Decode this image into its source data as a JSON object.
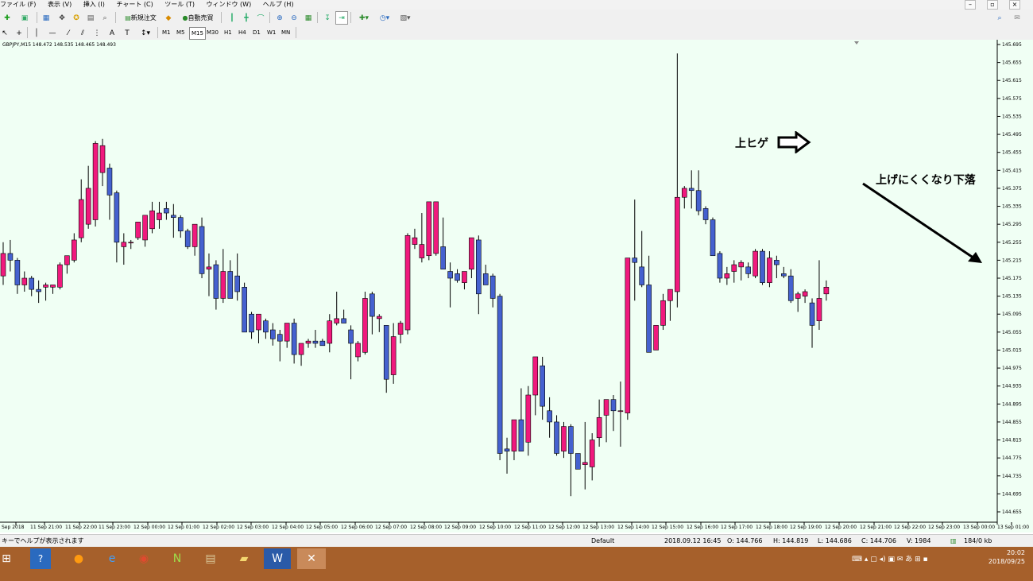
{
  "menu": {
    "items": [
      "ファイル (F)",
      "表示 (V)",
      "挿入 (I)",
      "チャート (C)",
      "ツール (T)",
      "ウィンドウ (W)",
      "ヘルプ (H)"
    ]
  },
  "toolbar": {
    "new_order": "新規注文",
    "auto_trade": "自動売買"
  },
  "timeframes": [
    "M1",
    "M5",
    "M15",
    "M30",
    "H1",
    "H4",
    "D1",
    "W1",
    "MN"
  ],
  "active_timeframe": "M15",
  "chart_header": "GBPJPY,M15  148.472 148.535 148.465 148.493",
  "annotations": {
    "upper_wick": "上ヒゲ",
    "not_rising": "上げにくくなり下落"
  },
  "status": {
    "help": "キーでヘルプが表示されます",
    "profile": "Default",
    "datetime": "2018.09.12 16:45",
    "open": "O: 144.766",
    "high": "H: 144.819",
    "low": "L: 144.686",
    "close": "C: 144.706",
    "volume": "V: 1984",
    "traffic": "184/0 kb"
  },
  "clock": {
    "time": "20:02",
    "date": "2018/09/25"
  },
  "colors": {
    "bull": "#f0197d",
    "bear": "#4561cf",
    "chart_bg": "#f0fff4"
  },
  "chart_data": {
    "type": "candlestick",
    "symbol": "GBPJPY",
    "timeframe": "M15",
    "ylim": [
      144.655,
      145.695
    ],
    "y_ticks": [
      "145.695",
      "145.655",
      "145.615",
      "145.575",
      "145.535",
      "145.495",
      "145.455",
      "145.415",
      "145.375",
      "145.335",
      "145.295",
      "145.255",
      "145.215",
      "145.175",
      "145.135",
      "145.095",
      "145.055",
      "145.015",
      "144.975",
      "144.935",
      "144.895",
      "144.855",
      "144.815",
      "144.775",
      "144.735",
      "144.695",
      "144.655"
    ],
    "x_ticks": [
      "Sep 2018",
      "11 Sep 21:00",
      "11 Sep 22:00",
      "11 Sep 23:00",
      "12 Sep 00:00",
      "12 Sep 01:00",
      "12 Sep 02:00",
      "12 Sep 03:00",
      "12 Sep 04:00",
      "12 Sep 05:00",
      "12 Sep 06:00",
      "12 Sep 07:00",
      "12 Sep 08:00",
      "12 Sep 09:00",
      "12 Sep 10:00",
      "12 Sep 11:00",
      "12 Sep 12:00",
      "12 Sep 13:00",
      "12 Sep 14:00",
      "12 Sep 15:00",
      "12 Sep 16:00",
      "12 Sep 17:00",
      "12 Sep 18:00",
      "12 Sep 19:00",
      "12 Sep 20:00",
      "12 Sep 21:00",
      "12 Sep 22:00",
      "12 Sep 23:00",
      "13 Sep 00:00",
      "13 Sep 01:00"
    ],
    "candles": [
      [
        145.18,
        145.255,
        145.16,
        145.23
      ],
      [
        145.23,
        145.26,
        145.19,
        145.215
      ],
      [
        145.215,
        145.22,
        145.14,
        145.16
      ],
      [
        145.16,
        145.19,
        145.145,
        145.175
      ],
      [
        145.175,
        145.18,
        145.135,
        145.15
      ],
      [
        145.15,
        145.17,
        145.12,
        145.145
      ],
      [
        145.155,
        145.165,
        145.125,
        145.16
      ],
      [
        145.155,
        145.16,
        145.14,
        145.16
      ],
      [
        145.155,
        145.21,
        145.15,
        145.205
      ],
      [
        145.205,
        145.225,
        145.185,
        145.225
      ],
      [
        145.215,
        145.275,
        145.21,
        145.26
      ],
      [
        145.265,
        145.395,
        145.255,
        145.35
      ],
      [
        145.295,
        145.425,
        145.285,
        145.375
      ],
      [
        145.305,
        145.48,
        145.29,
        145.475
      ],
      [
        145.41,
        145.485,
        145.38,
        145.47
      ],
      [
        145.42,
        145.43,
        145.305,
        145.36
      ],
      [
        145.365,
        145.37,
        145.21,
        145.255
      ],
      [
        145.245,
        145.275,
        145.205,
        145.255
      ],
      [
        145.255,
        145.26,
        145.24,
        145.255
      ],
      [
        145.265,
        145.3,
        145.26,
        145.3
      ],
      [
        145.26,
        145.305,
        145.245,
        145.315
      ],
      [
        145.285,
        145.345,
        145.275,
        145.325
      ],
      [
        145.305,
        145.345,
        145.285,
        145.32
      ],
      [
        145.33,
        145.345,
        145.305,
        145.32
      ],
      [
        145.315,
        145.34,
        145.265,
        145.31
      ],
      [
        145.31,
        145.315,
        145.265,
        145.28
      ],
      [
        145.28,
        145.285,
        145.24,
        145.245
      ],
      [
        145.245,
        145.295,
        145.225,
        145.295
      ],
      [
        145.29,
        145.31,
        145.175,
        145.185
      ],
      [
        145.195,
        145.23,
        145.135,
        145.2
      ],
      [
        145.205,
        145.215,
        145.105,
        145.13
      ],
      [
        145.13,
        145.24,
        145.12,
        145.19
      ],
      [
        145.19,
        145.215,
        145.135,
        145.13
      ],
      [
        145.18,
        145.23,
        145.125,
        145.145
      ],
      [
        145.155,
        145.165,
        145.055,
        145.055
      ],
      [
        145.095,
        145.1,
        145.04,
        145.055
      ],
      [
        145.06,
        145.095,
        145.03,
        145.095
      ],
      [
        145.08,
        145.085,
        145.04,
        145.055
      ],
      [
        145.06,
        145.075,
        145.025,
        145.04
      ],
      [
        145.05,
        145.06,
        144.99,
        145.035
      ],
      [
        145.035,
        145.065,
        145.02,
        145.075
      ],
      [
        145.075,
        145.085,
        144.985,
        145.005
      ],
      [
        145.005,
        145.02,
        144.98,
        145.03
      ],
      [
        145.03,
        145.04,
        145.02,
        145.035
      ],
      [
        145.035,
        145.06,
        145.02,
        145.03
      ],
      [
        145.035,
        145.04,
        145.025,
        145.025
      ],
      [
        145.03,
        145.095,
        145.01,
        145.08
      ],
      [
        145.075,
        145.145,
        145.07,
        145.085
      ],
      [
        145.085,
        145.105,
        145.075,
        145.075
      ],
      [
        145.06,
        145.07,
        144.95,
        145.03
      ],
      [
        145.0,
        145.035,
        144.99,
        145.03
      ],
      [
        145.01,
        145.145,
        145.005,
        145.13
      ],
      [
        145.14,
        145.145,
        145.05,
        145.09
      ],
      [
        145.085,
        145.095,
        145.055,
        145.09
      ],
      [
        145.07,
        145.07,
        144.92,
        144.95
      ],
      [
        144.96,
        145.075,
        144.94,
        145.045
      ],
      [
        145.05,
        145.08,
        145.03,
        145.075
      ],
      [
        145.06,
        145.275,
        145.05,
        145.27
      ],
      [
        145.25,
        145.285,
        145.24,
        145.265
      ],
      [
        145.22,
        145.32,
        145.21,
        145.25
      ],
      [
        145.225,
        145.3,
        145.215,
        145.345
      ],
      [
        145.23,
        145.345,
        145.225,
        145.345
      ],
      [
        145.245,
        145.31,
        145.23,
        145.195
      ],
      [
        145.19,
        145.21,
        145.11,
        145.175
      ],
      [
        145.185,
        145.195,
        145.165,
        145.17
      ],
      [
        145.165,
        145.185,
        145.15,
        145.19
      ],
      [
        145.195,
        145.25,
        145.175,
        145.265
      ],
      [
        145.26,
        145.27,
        145.095,
        145.14
      ],
      [
        145.185,
        145.205,
        145.16,
        145.16
      ],
      [
        145.18,
        145.185,
        145.11,
        145.13
      ],
      [
        145.135,
        145.14,
        144.77,
        144.785
      ],
      [
        144.795,
        144.82,
        144.74,
        144.79
      ],
      [
        144.79,
        144.84,
        144.77,
        144.86
      ],
      [
        144.86,
        144.93,
        144.79,
        144.79
      ],
      [
        144.81,
        144.935,
        144.78,
        144.915
      ],
      [
        144.915,
        144.98,
        144.87,
        145.0
      ],
      [
        144.98,
        145.0,
        144.86,
        144.89
      ],
      [
        144.88,
        144.91,
        144.82,
        144.855
      ],
      [
        144.855,
        144.87,
        144.78,
        144.785
      ],
      [
        144.79,
        144.855,
        144.775,
        144.845
      ],
      [
        144.845,
        144.85,
        144.69,
        144.785
      ],
      [
        144.785,
        144.78,
        144.76,
        144.75
      ],
      [
        144.76,
        144.855,
        144.705,
        144.765
      ],
      [
        144.755,
        144.83,
        144.725,
        144.815
      ],
      [
        144.82,
        144.905,
        144.8,
        144.865
      ],
      [
        144.87,
        144.9,
        144.81,
        144.905
      ],
      [
        144.905,
        144.915,
        144.835,
        144.88
      ],
      [
        144.88,
        144.945,
        144.8,
        144.88
      ],
      [
        144.875,
        145.215,
        144.86,
        145.22
      ],
      [
        145.22,
        145.35,
        145.125,
        145.21
      ],
      [
        145.2,
        145.28,
        145.155,
        145.16
      ],
      [
        145.16,
        145.225,
        145.05,
        145.01
      ],
      [
        145.015,
        145.06,
        145.02,
        145.07
      ],
      [
        145.07,
        145.14,
        145.06,
        145.125
      ],
      [
        145.125,
        145.15,
        145.08,
        145.15
      ],
      [
        145.145,
        145.675,
        145.11,
        145.355
      ],
      [
        145.355,
        145.38,
        145.33,
        145.375
      ],
      [
        145.375,
        145.415,
        145.33,
        145.37
      ],
      [
        145.37,
        145.415,
        145.315,
        145.325
      ],
      [
        145.33,
        145.335,
        145.295,
        145.305
      ],
      [
        145.305,
        145.31,
        145.225,
        145.225
      ],
      [
        145.23,
        145.235,
        145.165,
        145.175
      ],
      [
        145.175,
        145.2,
        145.16,
        145.185
      ],
      [
        145.19,
        145.215,
        145.165,
        145.205
      ],
      [
        145.2,
        145.215,
        145.17,
        145.21
      ],
      [
        145.2,
        145.21,
        145.175,
        145.185
      ],
      [
        145.18,
        145.24,
        145.175,
        145.235
      ],
      [
        145.235,
        145.24,
        145.16,
        145.165
      ],
      [
        145.165,
        145.235,
        145.155,
        145.22
      ],
      [
        145.215,
        145.225,
        145.175,
        145.205
      ],
      [
        145.185,
        145.2,
        145.175,
        145.18
      ],
      [
        145.18,
        145.195,
        145.12,
        145.125
      ],
      [
        145.13,
        145.145,
        145.1,
        145.14
      ],
      [
        145.135,
        145.15,
        145.12,
        145.145
      ],
      [
        145.12,
        145.13,
        145.02,
        145.07
      ],
      [
        145.08,
        145.215,
        145.06,
        145.13
      ],
      [
        145.14,
        145.17,
        145.125,
        145.155
      ]
    ]
  }
}
